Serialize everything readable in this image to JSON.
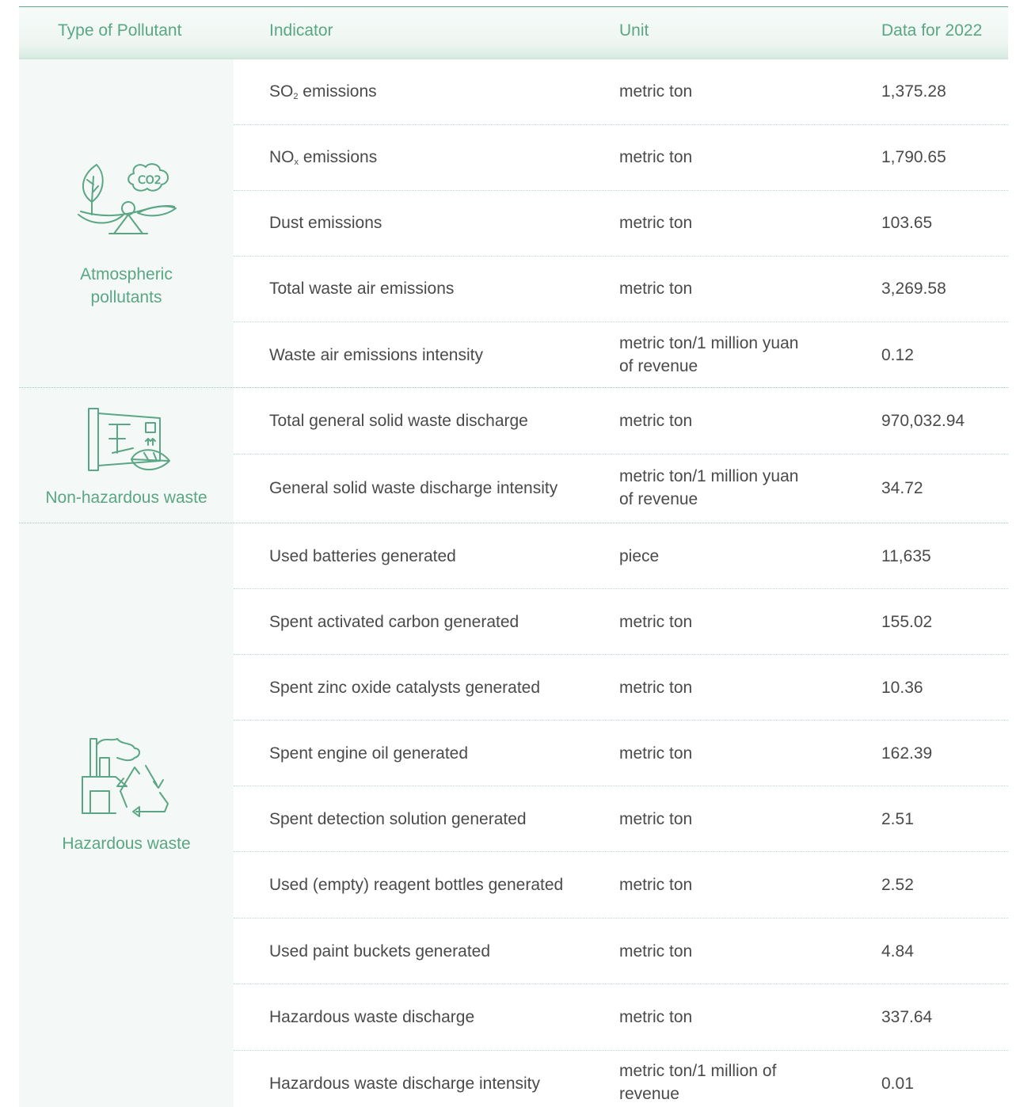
{
  "headers": {
    "type": "Type of Pollutant",
    "indicator": "Indicator",
    "unit": "Unit",
    "data": "Data for 2022"
  },
  "categories": {
    "atmospheric": {
      "label_line1": "Atmospheric",
      "label_line2": "pollutants",
      "icon": "leaf-co2-scale-icon"
    },
    "nonhazardous": {
      "label": "Non-hazardous waste",
      "icon": "waste-container-leaf-icon"
    },
    "hazardous": {
      "label": "Hazardous waste",
      "icon": "factory-recycle-icon"
    }
  },
  "rows": [
    {
      "ind_pre": "SO",
      "ind_sub": "2",
      "ind_post": " emissions",
      "unit": "metric ton",
      "value": "1,375.28"
    },
    {
      "ind_pre": "NO",
      "ind_sub": "x",
      "ind_post": " emissions",
      "unit": "metric ton",
      "value": "1,790.65"
    },
    {
      "indicator": "Dust emissions",
      "unit": "metric ton",
      "value": "103.65"
    },
    {
      "indicator": "Total waste air emissions",
      "unit": "metric ton",
      "value": "3,269.58"
    },
    {
      "indicator": "Waste air emissions intensity",
      "unit_line1": "metric ton/1 million yuan",
      "unit_line2": "of revenue",
      "value": "0.12"
    },
    {
      "indicator": "Total general solid waste discharge",
      "unit": "metric ton",
      "value": "970,032.94"
    },
    {
      "indicator": "General solid waste discharge intensity",
      "unit_line1": "metric ton/1 million yuan",
      "unit_line2": "of revenue",
      "value": "34.72"
    },
    {
      "indicator": "Used batteries generated",
      "unit": "piece",
      "value": "11,635"
    },
    {
      "indicator": "Spent activated carbon generated",
      "unit": "metric ton",
      "value": "155.02"
    },
    {
      "indicator": "Spent zinc oxide catalysts generated",
      "unit": "metric ton",
      "value": "10.36"
    },
    {
      "indicator": "Spent engine oil generated",
      "unit": "metric ton",
      "value": "162.39"
    },
    {
      "indicator": "Spent detection solution generated",
      "unit": "metric ton",
      "value": "2.51"
    },
    {
      "indicator": "Used (empty) reagent bottles generated",
      "unit": "metric ton",
      "value": "2.52"
    },
    {
      "indicator": "Used paint buckets generated",
      "unit": "metric ton",
      "value": "4.84"
    },
    {
      "indicator": "Hazardous waste discharge",
      "unit": "metric ton",
      "value": "337.64"
    },
    {
      "indicator": "Hazardous waste discharge intensity",
      "unit_line1": "metric ton/1 million of",
      "unit_line2": "revenue",
      "value": "0.01"
    }
  ],
  "colors": {
    "accent": "#5aa685",
    "text": "#4a4a4a",
    "category_bg": "#f4f8f6"
  }
}
